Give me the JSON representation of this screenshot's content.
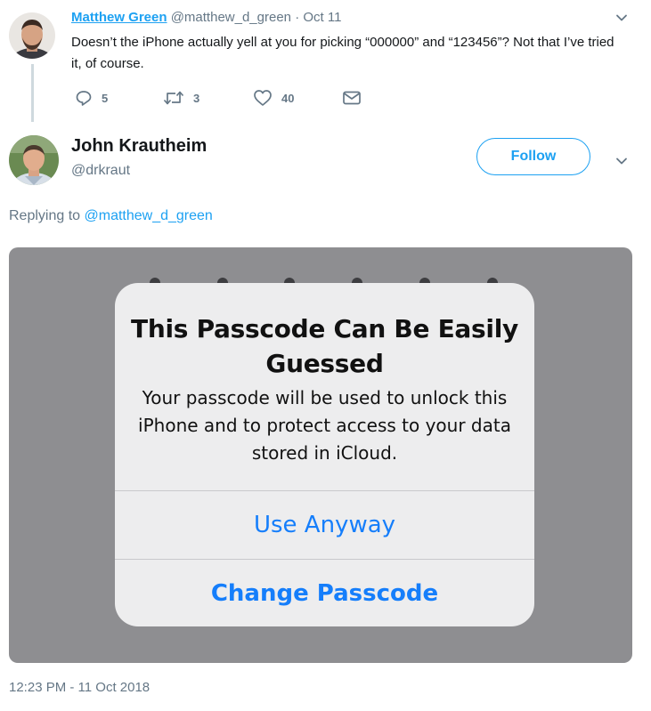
{
  "reply_tweet": {
    "author_name": "Matthew Green",
    "author_handle": "@matthew_d_green",
    "separator": "·",
    "date": "Oct 11",
    "text": "Doesn’t the iPhone actually yell at you for picking “000000” and “123456”? Not that I’ve tried it, of course.",
    "replies": "5",
    "retweets": "3",
    "likes": "40"
  },
  "main_tweet": {
    "author_name": "John Krautheim",
    "author_handle": "@drkraut",
    "follow_label": "Follow",
    "replying_prefix": "Replying to",
    "replying_to": "@matthew_d_green",
    "timestamp": "12:23 PM - 11 Oct 2018"
  },
  "media": {
    "alert_title": "This Passcode Can Be Easily Guessed",
    "alert_message": "Your passcode will be used to unlock this iPhone and to protect access to your data stored in iCloud.",
    "use_anyway_label": "Use Anyway",
    "change_passcode_label": "Change Passcode"
  },
  "icons": {
    "reply": "reply-icon",
    "retweet": "retweet-icon",
    "like": "heart-icon",
    "dm": "envelope-icon",
    "caret": "chevron-down-icon"
  },
  "colors": {
    "twitter_blue": "#1da1f2",
    "ios_blue": "#157efb",
    "muted_text": "#657786",
    "media_background": "#8e8e91",
    "alert_background": "#ededee"
  }
}
